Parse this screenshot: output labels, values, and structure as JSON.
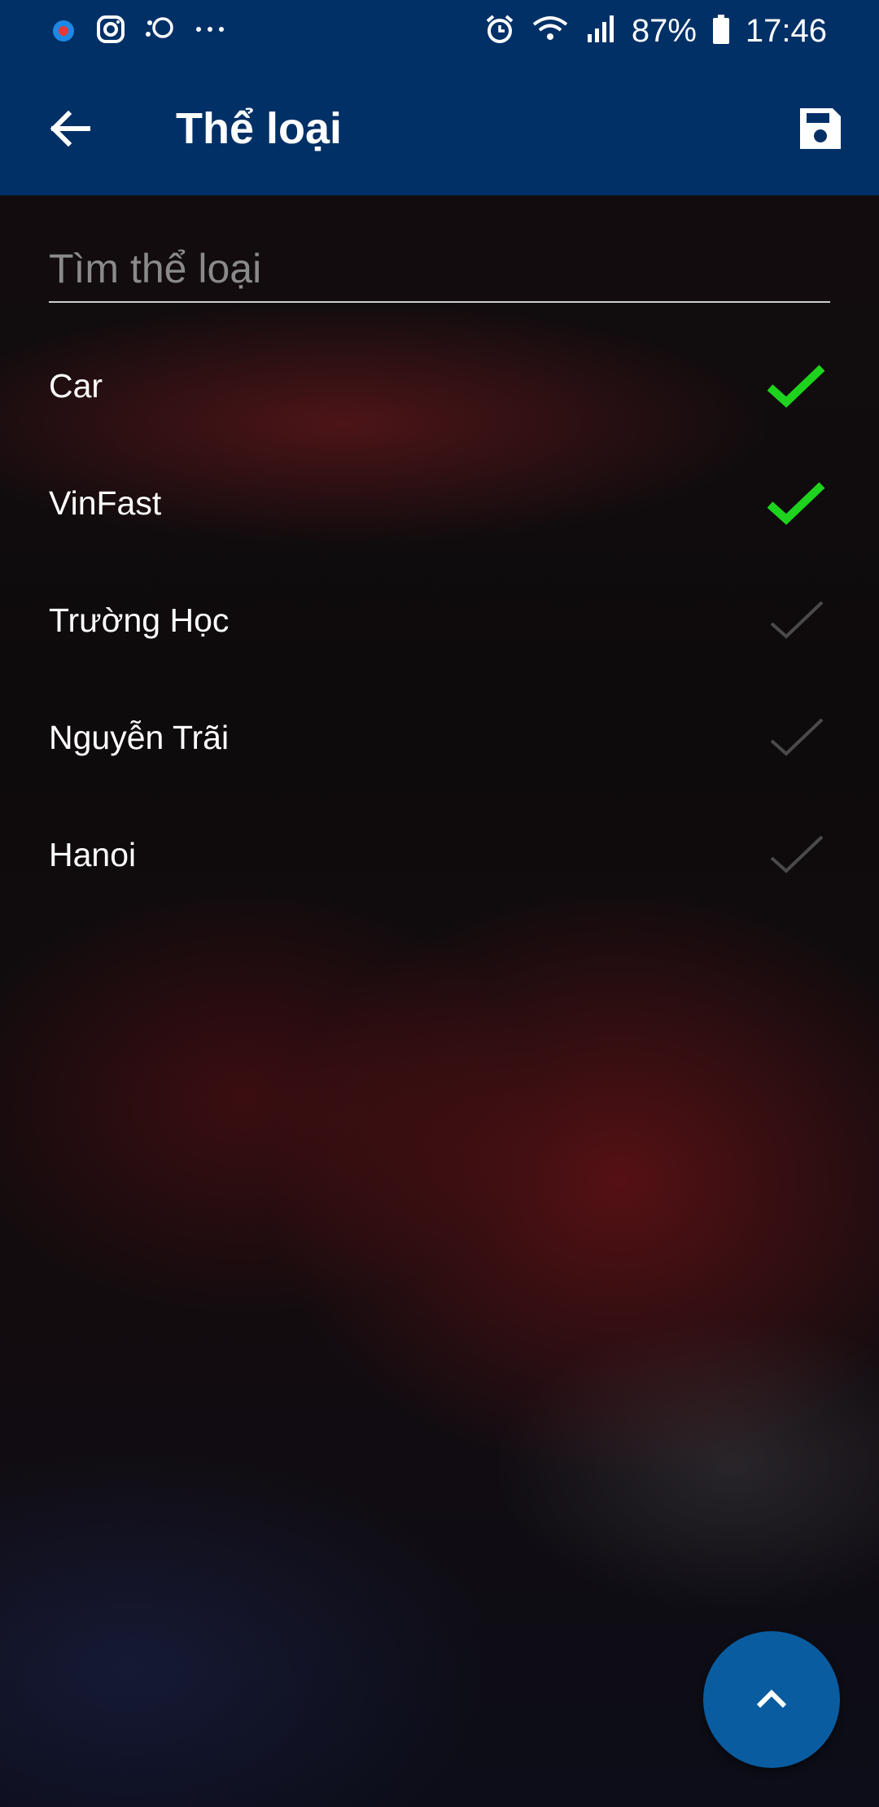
{
  "status_bar": {
    "battery": "87%",
    "time": "17:46",
    "left_icons": [
      "notification-icon",
      "instagram-icon",
      "app-icon",
      "more-dots-icon"
    ],
    "right_icons": [
      "alarm-icon",
      "wifi-icon",
      "signal-icon",
      "battery-icon"
    ]
  },
  "app_bar": {
    "title": "Thể loại",
    "back_icon": "arrow-left-icon",
    "save_icon": "save-icon"
  },
  "search": {
    "placeholder": "Tìm thể loại",
    "value": ""
  },
  "categories": [
    {
      "label": "Car",
      "checked": true
    },
    {
      "label": "VinFast",
      "checked": true
    },
    {
      "label": "Trường Học",
      "checked": false
    },
    {
      "label": "Nguyễn Trãi",
      "checked": false
    },
    {
      "label": "Hanoi",
      "checked": false
    }
  ],
  "colors": {
    "app_bar": "#003066",
    "checked": "#1ed31e",
    "unchecked": "#4a4a4a",
    "fab": "#0a5ca0"
  },
  "fab": {
    "icon": "chevron-up-icon"
  }
}
